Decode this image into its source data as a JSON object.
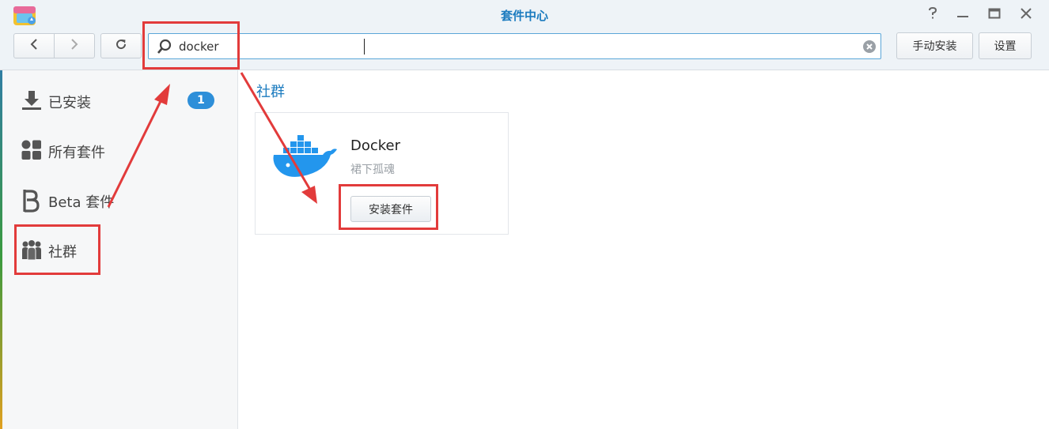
{
  "window": {
    "title": "套件中心",
    "icons": [
      "app-icon",
      "help-icon",
      "minimize-icon",
      "maximize-icon",
      "close-icon"
    ]
  },
  "toolbar": {
    "back_icon": "chevron-left-icon",
    "forward_icon": "chevron-right-icon",
    "refresh_icon": "refresh-icon",
    "search": {
      "value": "docker",
      "icon": "search-icon",
      "clear_icon": "clear-icon"
    },
    "manual_install_label": "手动安装",
    "settings_label": "设置"
  },
  "sidebar": {
    "items": [
      {
        "label": "已安装",
        "icon": "download-icon",
        "badge": "1"
      },
      {
        "label": "所有套件",
        "icon": "grid-icon"
      },
      {
        "label": "Beta 套件",
        "icon": "beta-icon"
      },
      {
        "label": "社群",
        "icon": "community-icon"
      }
    ]
  },
  "main": {
    "section_title": "社群",
    "package": {
      "name": "Docker",
      "author": "裙下孤魂",
      "icon": "docker-whale-icon",
      "install_label": "安装套件"
    }
  },
  "colors": {
    "accent": "#1b7bbf",
    "badge": "#2e8fd9",
    "annotation": "#e23b3b",
    "docker_blue": "#2396ed"
  }
}
